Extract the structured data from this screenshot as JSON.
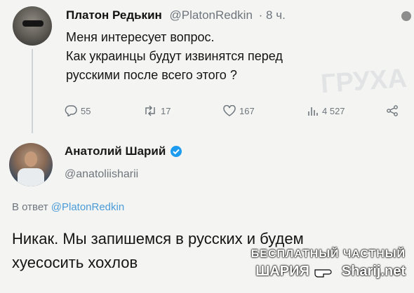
{
  "tweet1": {
    "name": "Платон Редькин",
    "handle": "@PlatonRedkin",
    "time": "· 8 ч.",
    "lines": [
      "Меня интересует вопрос.",
      "Как украинцы будут извинятся перед",
      "русскими после всего этого ?"
    ],
    "actions": {
      "replies": "55",
      "retweets": "17",
      "likes": "167",
      "views": "4 527"
    }
  },
  "tweet2": {
    "name": "Анатолий Шарий",
    "handle": "@anatoliisharii",
    "reply_prefix": "В ответ",
    "reply_handle": "@PlatonRedkin",
    "lines": [
      "Никак. Мы запишемся в русских и будем",
      "хуесосить хохлов"
    ]
  },
  "watermark": {
    "line1": "БЕСПЛАТНЫЙ ЧАСТНЫЙ",
    "line2": "ШАРИЯ",
    "site": "Sharij.net"
  },
  "colors": {
    "background": "#f4f4f2",
    "verified": "#1d9bf0",
    "link": "#4a9bd8",
    "muted": "#6e767d"
  }
}
